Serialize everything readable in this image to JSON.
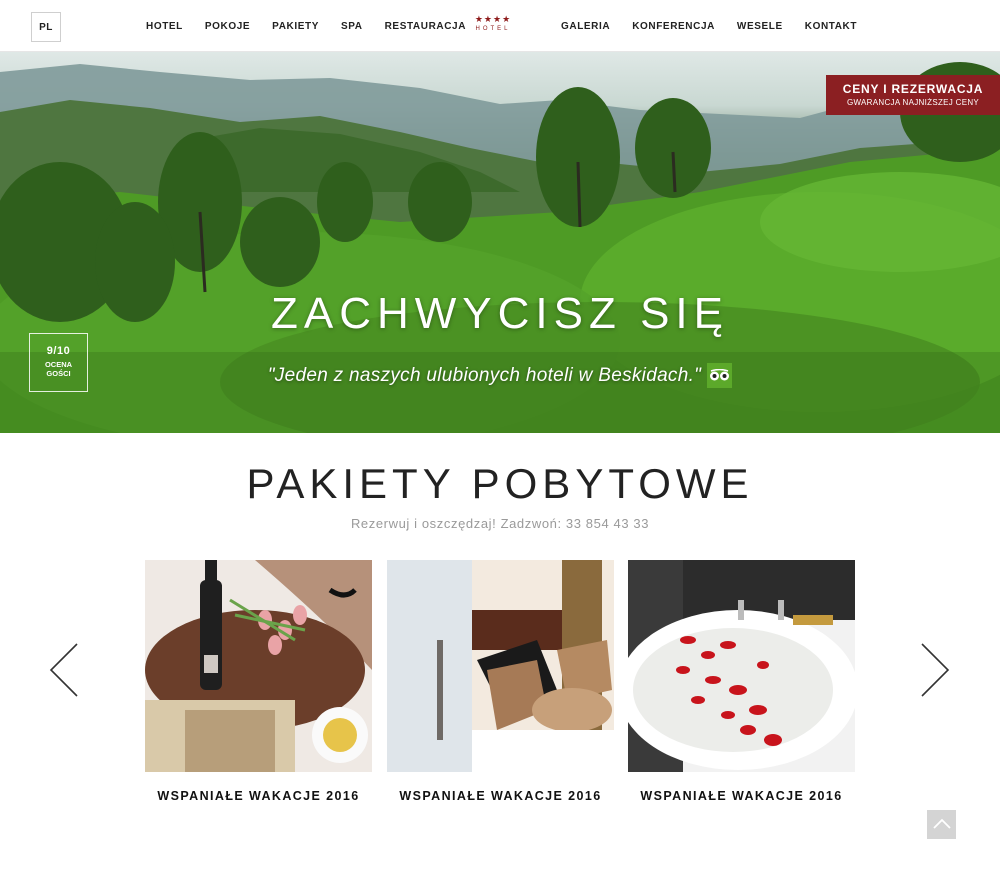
{
  "header": {
    "language": "PL",
    "nav_left": [
      "HOTEL",
      "POKOJE",
      "PAKIETY",
      "SPA",
      "RESTAURACJA"
    ],
    "nav_right": [
      "GALERIA",
      "KONFERENCJA",
      "WESELE",
      "KONTAKT"
    ],
    "logo": {
      "stars": "★★★★",
      "word": "HOTEL"
    }
  },
  "hero": {
    "title": "ZACHWYCISZ SIĘ",
    "quote": "\"Jeden z naszych ulubionych hoteli w Beskidach.\"",
    "rating": {
      "score": "9/10",
      "label_line1": "OCENA",
      "label_line2": "GOŚCI"
    },
    "booking": {
      "title": "CENY I REZERWACJA",
      "subtitle": "GWARANCJA NAJNIŻSZEJ CENY"
    }
  },
  "packages": {
    "title": "PAKIETY POBYTOWE",
    "subtitle": "Rezerwuj i oszczędzaj! Zadzwoń: 33 854 43 33",
    "cards": [
      {
        "label": "WSPANIAŁE WAKACJE 2016"
      },
      {
        "label": "WSPANIAŁE WAKACJE 2016"
      },
      {
        "label": "WSPANIAŁE WAKACJE 2016"
      }
    ]
  },
  "colors": {
    "brand": "#8b1f22",
    "tripadvisor": "#5ca92a"
  },
  "icons": {
    "prev": "chevron-left-icon",
    "next": "chevron-right-icon",
    "top": "chevron-up-icon",
    "tripadvisor": "tripadvisor-owl-icon"
  }
}
